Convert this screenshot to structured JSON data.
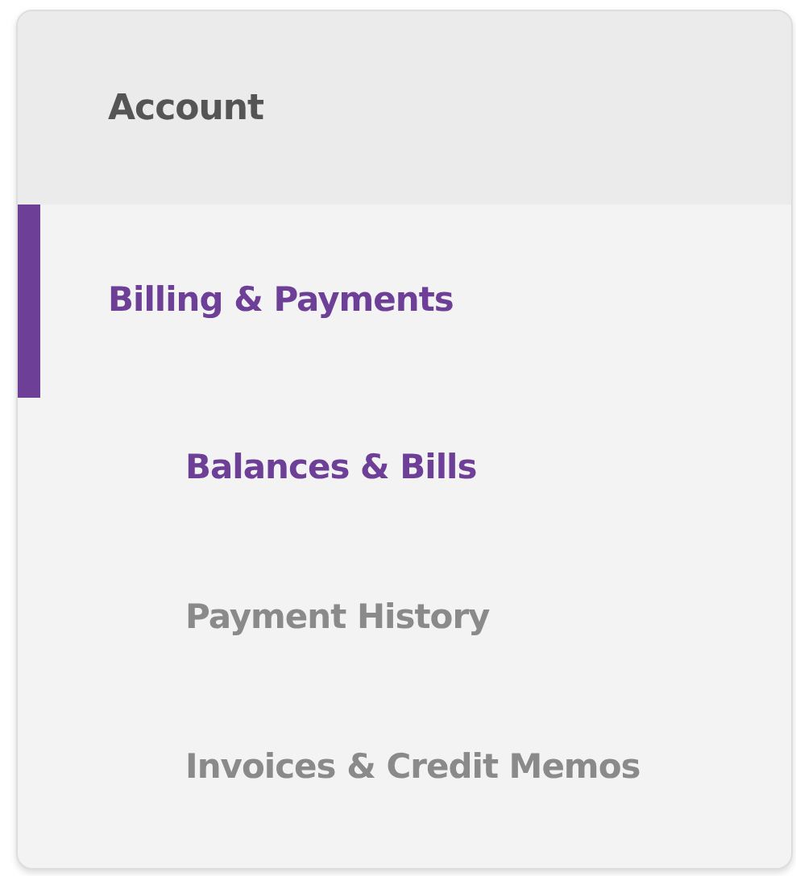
{
  "menu": {
    "header": "Account",
    "section": {
      "label": "Billing & Payments",
      "selected": true
    },
    "items": [
      {
        "label": "Balances & Bills",
        "selected": true
      },
      {
        "label": "Payment History",
        "selected": false
      },
      {
        "label": "Invoices & Credit Memos",
        "selected": false
      }
    ]
  }
}
